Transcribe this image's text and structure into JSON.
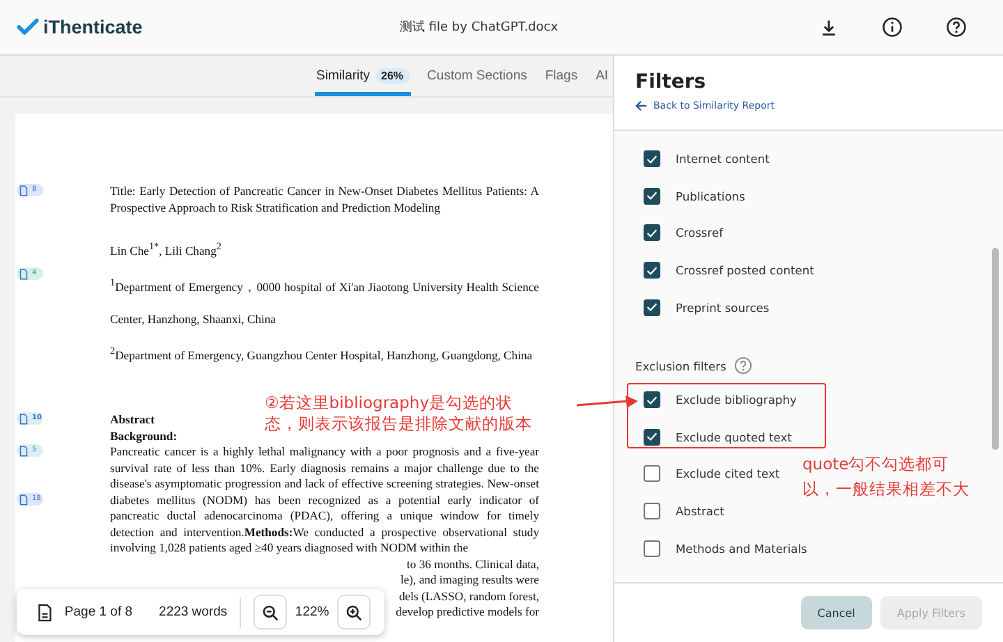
{
  "header": {
    "logo": "iThenticate",
    "file_title": "测试 file by ChatGPT.docx"
  },
  "tabs": [
    {
      "label": "Similarity",
      "badge": "26%",
      "selected": true
    },
    {
      "label": "Custom Sections",
      "selected": false
    },
    {
      "label": "Flags",
      "selected": false
    },
    {
      "label": "AI",
      "selected": false
    }
  ],
  "document": {
    "blocks": [
      {
        "kind": "title",
        "text": "Title: Early Detection of Pancreatic Cancer in New-Onset Diabetes Mellitus Patients: A Prospective Approach to Risk Stratification and Prediction Modeling",
        "markers": [
          {
            "count": "8",
            "color": "#dbe6fb"
          }
        ]
      },
      {
        "kind": "authors",
        "text": "Lin Che$^{1*}$, Lili Chang$^{2}$"
      },
      {
        "kind": "affil",
        "text": "$^{1}$Department of Emergency，0000 hospital of  Xi'an Jiaotong University Health Science Center, Hanzhong, Shaanxi, China",
        "markers": [
          {
            "count": "4",
            "color": "#d5f1e6"
          }
        ]
      },
      {
        "kind": "affil",
        "text": "$^{2}$Department of Emergency, Guangzhou Center Hospital, Hanzhong, Guangdong, China"
      },
      {
        "kind": "heading",
        "text": "Abstract",
        "markers": [
          {
            "count": "10",
            "color": "#d9f0ef"
          }
        ]
      },
      {
        "kind": "heading",
        "text": "Background:"
      },
      {
        "kind": "body",
        "text": "Pancreatic cancer is a highly lethal malignancy with a poor prognosis and a five-year survival rate of less than 10%. Early diagnosis remains a major challenge due to the disease's asymptomatic progression and lack of effective screening strategies. New-onset diabetes mellitus (NODM) has been recognized as a potential early indicator of pancreatic ductal adenocarcinoma (PDAC), offering a unique window for timely detection and intervention.**Methods:**We conducted a prospective observational study involving 1,028 patients aged ≥40 years diagnosed with NODM within the",
        "markers": [
          {
            "count": "5",
            "color": "#d9f0ef"
          },
          {
            "count": "18",
            "color": "#dbe6fb"
          }
        ]
      },
      {
        "kind": "fragment",
        "text": "to 36 months. Clinical data,"
      },
      {
        "kind": "fragment",
        "text": "le), and imaging results were"
      },
      {
        "kind": "fragment",
        "text": "dels (LASSO, random forest,"
      },
      {
        "kind": "fragment",
        "text": "develop predictive models for"
      }
    ]
  },
  "toolbar": {
    "page": "Page 1 of 8",
    "words": "2223 words",
    "zoom": "122%"
  },
  "filters": {
    "title": "Filters",
    "back_link": "Back to Similarity Report",
    "sections": [
      {
        "items": [
          {
            "label": "Internet content",
            "checked": true
          },
          {
            "label": "Publications",
            "checked": true
          },
          {
            "label": "Crossref",
            "checked": true
          },
          {
            "label": "Crossref posted content",
            "checked": true
          },
          {
            "label": "Preprint sources",
            "checked": true
          }
        ]
      },
      {
        "heading": "Exclusion filters",
        "items": [
          {
            "label": "Exclude bibliography",
            "checked": true
          },
          {
            "label": "Exclude quoted text",
            "checked": true
          },
          {
            "label": "Exclude cited text",
            "checked": false
          },
          {
            "label": "Abstract",
            "checked": false
          },
          {
            "label": "Methods and Materials",
            "checked": false
          }
        ]
      }
    ],
    "buttons": [
      {
        "label": "Cancel",
        "disabled": false
      },
      {
        "label": "Apply Filters",
        "disabled": true
      }
    ]
  },
  "annotations": [
    {
      "text": "②若这里bibliography是勾选的状态，则表示该报告是排除文献的版本"
    },
    {
      "text": "quote勾不勾选都可以，一般结果相差不大"
    }
  ]
}
